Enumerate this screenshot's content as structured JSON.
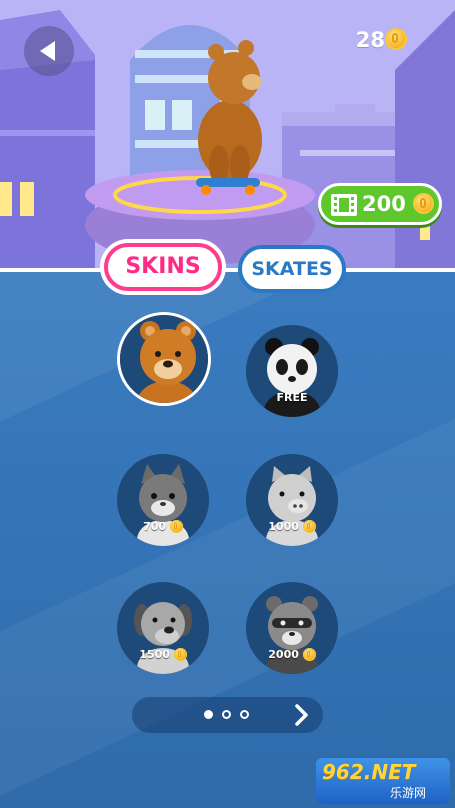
{
  "header": {
    "coins": "28",
    "coin_icon": "gold-coin-icon",
    "back_icon": "back-arrow-icon",
    "video_reward": "200",
    "video_icon": "film-video-icon"
  },
  "tabs": [
    {
      "label": "SKINS",
      "selected": true
    },
    {
      "label": "SKATES",
      "selected": false
    }
  ],
  "skins": [
    {
      "name": "bear",
      "price": "",
      "selected": true
    },
    {
      "name": "panda",
      "price": "FREE",
      "selected": false
    },
    {
      "name": "cat",
      "price": "700",
      "selected": false
    },
    {
      "name": "pig",
      "price": "1000",
      "selected": false
    },
    {
      "name": "dog",
      "price": "1500",
      "selected": false
    },
    {
      "name": "raccoon",
      "price": "2000",
      "selected": false
    }
  ],
  "pager": {
    "pages": 3,
    "current": 1,
    "next_icon": "chevron-right-icon"
  },
  "watermark": {
    "brand": "962.NET",
    "sub": "乐游网"
  },
  "colors": {
    "accent_pink": "#ff2a86",
    "accent_blue": "#2a79c4",
    "green": "#5dc72b",
    "coin": "#f6b21a"
  }
}
